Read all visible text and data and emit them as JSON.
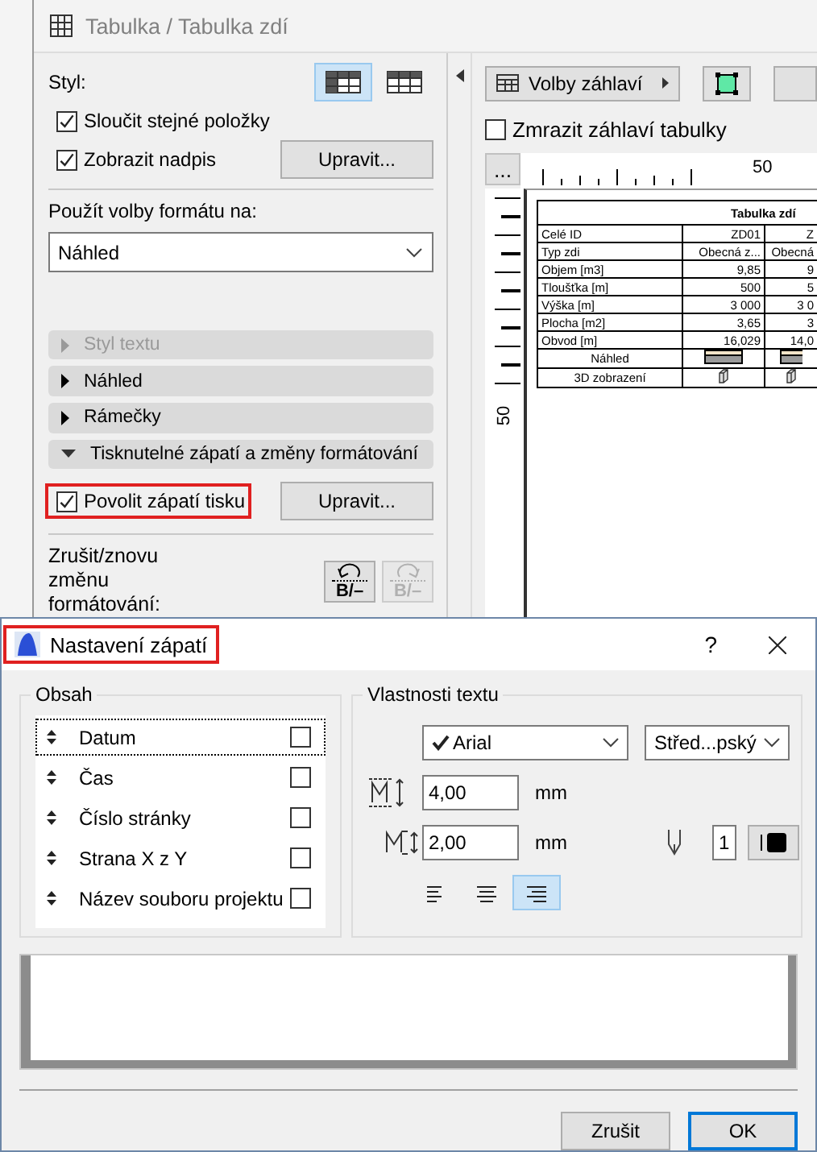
{
  "window": {
    "title": "Tabulka / Tabulka zdí"
  },
  "format_panel": {
    "style_label": "Styl:",
    "style_options": [
      {
        "selected": true
      },
      {
        "selected": false
      }
    ],
    "merge_items": {
      "label": "Sloučit stejné položky",
      "checked": true
    },
    "show_title": {
      "label": "Zobrazit nadpis",
      "checked": true
    },
    "edit_title_button": "Upravit...",
    "apply_label": "Použít volby formátu na:",
    "apply_select": {
      "value": "Náhled"
    },
    "sections": [
      {
        "label": "Styl textu",
        "expanded": false,
        "disabled": true
      },
      {
        "label": "Náhled",
        "expanded": false,
        "disabled": false
      },
      {
        "label": "Rámečky",
        "expanded": false,
        "disabled": false
      },
      {
        "label": "Tisknutelné zápatí a změny formátování",
        "expanded": true,
        "disabled": false
      }
    ],
    "print_footer": {
      "label": "Povolit zápatí tisku",
      "checked": true,
      "highlighted": true
    },
    "edit_footer_button": "Upravit...",
    "undo_label": "Zrušit/znovu změnu formátování:",
    "undo_buttons": [
      {
        "kind": "undo",
        "label": "B/–",
        "disabled": false
      },
      {
        "kind": "redo",
        "label": "B/–",
        "disabled": true
      }
    ]
  },
  "preview_panel": {
    "header_options_button": "Volby záhlaví",
    "freeze_header": {
      "label": "Zmrazit záhlaví tabulky",
      "checked": false
    },
    "ruler_button": "...",
    "ruler_labels": {
      "horizontal": "50",
      "vertical": "50"
    },
    "table": {
      "title": "Tabulka zdí",
      "rows": [
        {
          "kind": "text",
          "cells": [
            "Celé ID",
            "ZD01",
            "Z"
          ]
        },
        {
          "kind": "text",
          "cells": [
            "Typ zdi",
            "Obecná z...",
            "Obecná"
          ]
        },
        {
          "kind": "text",
          "cells": [
            "Objem [m3]",
            "9,85",
            "9"
          ]
        },
        {
          "kind": "text",
          "cells": [
            "Tloušťka [m]",
            "500",
            "5"
          ]
        },
        {
          "kind": "text",
          "cells": [
            "Výška [m]",
            "3 000",
            "3 0"
          ]
        },
        {
          "kind": "text",
          "cells": [
            "Plocha [m2]",
            "3,65",
            "3"
          ]
        },
        {
          "kind": "text",
          "cells": [
            "Obvod [m]",
            "16,029",
            "14,0"
          ]
        },
        {
          "kind": "preview",
          "cells": [
            "Náhled"
          ]
        },
        {
          "kind": "model",
          "cells": [
            "3D zobrazení"
          ]
        }
      ]
    }
  },
  "dialog": {
    "title": "Nastavení zápatí",
    "highlighted": true,
    "help": "?",
    "content_group": {
      "title": "Obsah",
      "items": [
        {
          "label": "Datum",
          "checked": false,
          "selected": true
        },
        {
          "label": "Čas",
          "checked": false,
          "selected": false
        },
        {
          "label": "Číslo stránky",
          "checked": false,
          "selected": false
        },
        {
          "label": "Strana X z Y",
          "checked": false,
          "selected": false
        },
        {
          "label": "Název souboru projektu",
          "checked": false,
          "selected": false
        }
      ]
    },
    "text_group": {
      "title": "Vlastnosti textu",
      "font": "Arial",
      "script": "Střed...pský",
      "height": {
        "value": "4,00",
        "unit": "mm"
      },
      "width": {
        "value": "2,00",
        "unit": "mm"
      },
      "pen": "1",
      "alignments": [
        {
          "kind": "left",
          "selected": false
        },
        {
          "kind": "center",
          "selected": false
        },
        {
          "kind": "right",
          "selected": true
        }
      ]
    },
    "buttons": [
      {
        "label": "Zrušit",
        "default": false
      },
      {
        "label": "OK",
        "default": true
      }
    ]
  }
}
